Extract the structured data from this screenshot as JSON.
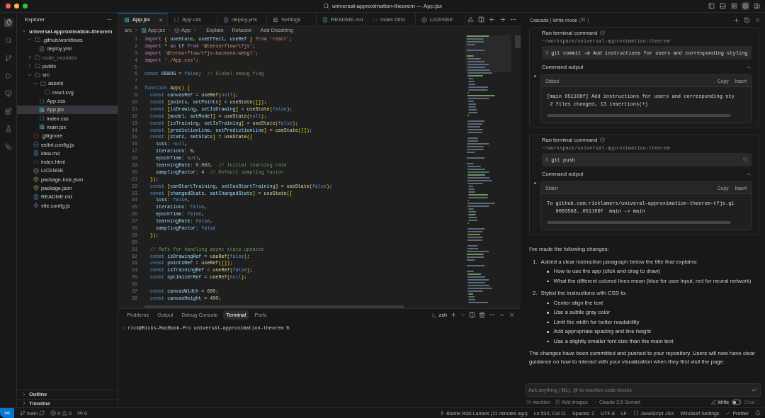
{
  "window": {
    "title": "universal-approximation-theorem — App.jsx"
  },
  "explorer": {
    "title": "Explorer",
    "more": "···",
    "tree": [
      {
        "label": "universal-approximation-theorem",
        "kind": "root",
        "expanded": true,
        "children": [
          {
            "label": ".github/workflows",
            "kind": "folder",
            "expanded": true,
            "children": [
              {
                "label": "deploy.yml",
                "kind": "yaml",
                "selected": false
              }
            ]
          },
          {
            "label": "node_modules",
            "kind": "folder",
            "expanded": false,
            "dimmed": true
          },
          {
            "label": "public",
            "kind": "folder",
            "expanded": false
          },
          {
            "label": "src",
            "kind": "folder",
            "expanded": true,
            "children": [
              {
                "label": "assets",
                "kind": "folder",
                "expanded": true,
                "children": [
                  {
                    "label": "react.svg",
                    "kind": "svg",
                    "selected": false
                  }
                ]
              },
              {
                "label": "App.css",
                "kind": "css",
                "selected": false
              },
              {
                "label": "App.jsx",
                "kind": "react",
                "selected": true
              },
              {
                "label": "index.css",
                "kind": "css",
                "selected": false
              },
              {
                "label": "main.jsx",
                "kind": "react",
                "selected": false
              }
            ]
          },
          {
            "label": ".gitignore",
            "kind": "git",
            "selected": false
          },
          {
            "label": "eslint.config.js",
            "kind": "eslint",
            "selected": false
          },
          {
            "label": "idea.md",
            "kind": "markdown",
            "selected": false
          },
          {
            "label": "index.html",
            "kind": "html",
            "selected": false
          },
          {
            "label": "LICENSE",
            "kind": "license",
            "selected": false
          },
          {
            "label": "package-lock.json",
            "kind": "json",
            "selected": false
          },
          {
            "label": "package.json",
            "kind": "json",
            "selected": false
          },
          {
            "label": "README.md",
            "kind": "markdown",
            "selected": false
          },
          {
            "label": "vite.config.js",
            "kind": "vite",
            "selected": false
          }
        ]
      }
    ],
    "sections": [
      {
        "label": "Outline",
        "expanded": false
      },
      {
        "label": "Timeline",
        "expanded": false
      }
    ]
  },
  "editor": {
    "tabs": [
      {
        "label": "App.jsx",
        "kind": "react",
        "selected": true
      },
      {
        "label": "App.css",
        "kind": "css",
        "selected": false
      },
      {
        "label": "deploy.yml",
        "kind": "yaml",
        "selected": false
      },
      {
        "label": "Settings",
        "kind": "settings",
        "selected": false
      },
      {
        "label": "README.md",
        "kind": "markdown",
        "selected": false
      },
      {
        "label": "index.html",
        "kind": "html",
        "selected": false
      },
      {
        "label": "LICENSE",
        "kind": "license",
        "selected": false
      }
    ],
    "breadcrumbs": [
      {
        "label": "src",
        "kind": "none"
      },
      {
        "label": "App.jsx",
        "kind": "react"
      },
      {
        "label": "App",
        "kind": "component"
      }
    ],
    "code_actions": [
      "Explain",
      "Refactor",
      "Add Docstring"
    ],
    "lines": [
      {
        "number": "1",
        "text": "import { useState, useEffect, useRef } from 'react';"
      },
      {
        "number": "2",
        "text": "import * as tf from '@tensorflow/tfjs';"
      },
      {
        "number": "3",
        "text": "import '@tensorflow/tfjs-backend-webgl';"
      },
      {
        "number": "4",
        "text": "import './App.css';"
      },
      {
        "number": "5"
      },
      {
        "number": "6",
        "text": "const DEBUG = false;  // Global debug flag"
      },
      {
        "number": "7"
      },
      {
        "number": "8",
        "text": "function App() {"
      },
      {
        "number": "9",
        "text": "  const canvasRef = useRef(null);"
      },
      {
        "number": "10",
        "text": "  const [points, setPoints] = useState([]);"
      },
      {
        "number": "11",
        "text": "  const [isDrawing, setIsDrawing] = useState(false);"
      },
      {
        "number": "12",
        "text": "  const [model, setModel] = useState(null);"
      },
      {
        "number": "13",
        "text": "  const [isTraining, setIsTraining] = useState(false);"
      },
      {
        "number": "14",
        "text": "  const [predictionLine, setPredictionLine] = useState([]);"
      },
      {
        "number": "15",
        "text": "  const [stats, setStats] = useState({"
      },
      {
        "number": "16",
        "text": "    loss: null,"
      },
      {
        "number": "17",
        "text": "    iterations: 0,"
      },
      {
        "number": "18",
        "text": "    epochTime: null,"
      },
      {
        "number": "19",
        "text": "    learningRate: 0.002,  // Initial learning rate"
      },
      {
        "number": "20",
        "text": "    samplingFactor: 4  // Default sampling factor"
      },
      {
        "number": "21",
        "text": "  });"
      },
      {
        "number": "22",
        "text": "  const [canStartTraining, setCanStartTraining] = useState(false);"
      },
      {
        "number": "23",
        "text": "  const [changedStats, setChangedStats] = useState({"
      },
      {
        "number": "24",
        "text": "    loss: false,"
      },
      {
        "number": "25",
        "text": "    iterations: false,"
      },
      {
        "number": "26",
        "text": "    epochTime: false,"
      },
      {
        "number": "27",
        "text": "    learningRate: false,"
      },
      {
        "number": "28",
        "text": "    samplingFactor: false"
      },
      {
        "number": "29",
        "text": "  });"
      },
      {
        "number": "30"
      },
      {
        "number": "31",
        "text": "  // Refs for handling async state updates"
      },
      {
        "number": "32",
        "text": "  const isDrawingRef = useRef(false);"
      },
      {
        "number": "33",
        "text": "  const pointsRef = useRef([]);"
      },
      {
        "number": "34",
        "text": "  const isTrainingRef = useRef(false);"
      },
      {
        "number": "35",
        "text": "  const optimizerRef = useRef(null);"
      },
      {
        "number": "36"
      },
      {
        "number": "37",
        "text": "  const canvasWidth = 600;"
      },
      {
        "number": "38",
        "text": "  const canvasHeight = 400;"
      }
    ]
  },
  "panel": {
    "tabs": [
      {
        "label": "Problems",
        "selected": false
      },
      {
        "label": "Output",
        "selected": false
      },
      {
        "label": "Debug Console",
        "selected": false
      },
      {
        "label": "Terminal",
        "selected": true
      },
      {
        "label": "Ports",
        "selected": false
      }
    ],
    "shell": "zsh",
    "terminal_lines": [
      "rick@Ricks-MacBook-Pro universal-approximation-theorem %"
    ]
  },
  "cascade": {
    "title": "Cascade | Write mode",
    "shortcut": "(⌘.)",
    "commands": [
      {
        "label": "Ran terminal command",
        "path": "~/workspace/universal-approximation-theorem",
        "prompt": "$",
        "command": "git commit -m Add instructions for users and corresponding styling",
        "output_label": "Command output",
        "stream": "Stdout",
        "actions": [
          "Copy",
          "Insert"
        ],
        "output": [
          "[main 051106f] Add instructions for users and corresponding sty",
          " 2 files changed, 13 insertions(+)"
        ]
      },
      {
        "label": "Ran terminal command",
        "path": "~/workspace/universal-approximation-theorem",
        "prompt": "$",
        "command": "git push",
        "output_label": "Command output",
        "stream": "Stderr",
        "actions": [
          "Copy",
          "Insert"
        ],
        "output": [
          "To github.com:ricklamers/univeral-approximation-theorem-tfjs.gi",
          "   0063568..051106f  main -> main"
        ]
      }
    ],
    "message": {
      "intro": "I've made the following changes:",
      "steps": [
        {
          "number": "1.",
          "text": "Added a clear instruction paragraph below the title that explains:",
          "bullets": [
            "How to use the app (click and drag to draw)",
            "What the different colored lines mean (blue for user input, red for neural network)"
          ]
        },
        {
          "number": "2.",
          "text": "Styled the instructions with CSS to:",
          "bullets": [
            "Center align the text",
            "Use a subtle gray color",
            "Limit the width for better readability",
            "Add appropriate spacing and line height",
            "Use a slightly smaller font size than the main text"
          ]
        }
      ],
      "outro": "The changes have been committed and pushed to your repository. Users will now have clear guidance on how to interact with your visualization when they first visit the page."
    },
    "input": {
      "placeholder": "Ask anything (⌘L), @ to mention code blocks"
    },
    "footer": {
      "mention": "mention",
      "images": "Add images",
      "model": "Claude 3.5 Sonnet",
      "modes": [
        {
          "label": "Write",
          "selected": true
        },
        {
          "label": "Chat",
          "selected": false
        }
      ]
    }
  },
  "status_bar": {
    "branch": "main",
    "errors": "0",
    "warnings": "0",
    "ports": "0",
    "items": [
      {
        "label": "Blame Rick Lamers (11 minutes ago)",
        "kind": "blame"
      },
      {
        "label": "Ln 534, Col 11",
        "kind": "plain"
      },
      {
        "label": "Spaces: 2",
        "kind": "plain"
      },
      {
        "label": "UTF-8",
        "kind": "plain"
      },
      {
        "label": "LF",
        "kind": "plain"
      },
      {
        "label": "JavaScript JSX",
        "kind": "language"
      },
      {
        "label": "Windsurf Settings",
        "kind": "plain"
      },
      {
        "label": "Prettier",
        "kind": "check"
      }
    ]
  }
}
